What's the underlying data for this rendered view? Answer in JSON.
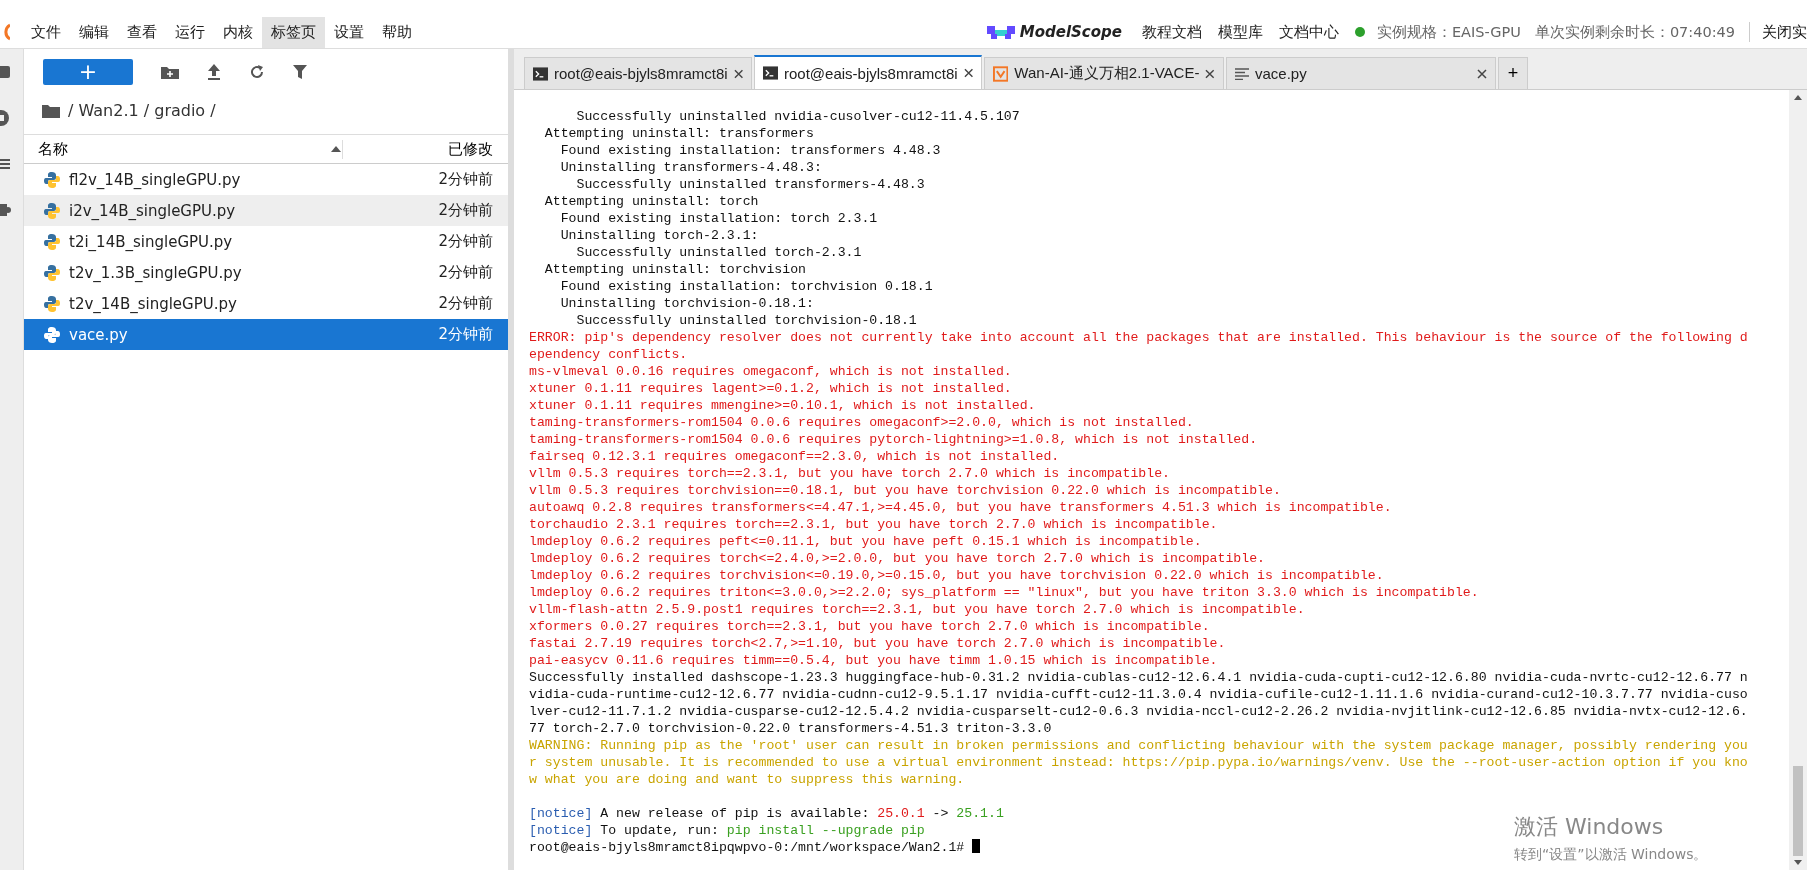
{
  "menu_bar": {
    "items": [
      {
        "label": "文件",
        "selected": false
      },
      {
        "label": "编辑",
        "selected": false
      },
      {
        "label": "查看",
        "selected": false
      },
      {
        "label": "运行",
        "selected": false
      },
      {
        "label": "内核",
        "selected": false
      },
      {
        "label": "标签页",
        "selected": true
      },
      {
        "label": "设置",
        "selected": false
      },
      {
        "label": "帮助",
        "selected": false
      }
    ],
    "brand": "ModelScope",
    "links": [
      "教程文档",
      "模型库",
      "文档中心"
    ],
    "instance_spec": "实例规格：EAIS-GPU",
    "time_left": "单次实例剩余时长：07:40:49",
    "close_button": "关闭实"
  },
  "file_browser": {
    "new_button": "+",
    "breadcrumb": "/ Wan2.1 / gradio /",
    "columns": [
      "名称",
      "已修改"
    ],
    "files": [
      {
        "name": "fl2v_14B_singleGPU.py",
        "modified": "2分钟前",
        "selected": false,
        "hovered": false
      },
      {
        "name": "i2v_14B_singleGPU.py",
        "modified": "2分钟前",
        "selected": false,
        "hovered": true
      },
      {
        "name": "t2i_14B_singleGPU.py",
        "modified": "2分钟前",
        "selected": false,
        "hovered": false
      },
      {
        "name": "t2v_1.3B_singleGPU.py",
        "modified": "2分钟前",
        "selected": false,
        "hovered": false
      },
      {
        "name": "t2v_14B_singleGPU.py",
        "modified": "2分钟前",
        "selected": false,
        "hovered": false
      },
      {
        "name": "vace.py",
        "modified": "2分钟前",
        "selected": true,
        "hovered": false
      }
    ]
  },
  "tabs": [
    {
      "kind": "terminal",
      "label": "root@eais-bjyls8mramct8i",
      "selected": false
    },
    {
      "kind": "terminal",
      "label": "root@eais-bjyls8mramct8i",
      "selected": true
    },
    {
      "kind": "web",
      "label": "Wan-AI-通义万相2.1-VACE-",
      "selected": false
    },
    {
      "kind": "file",
      "label": "vace.py",
      "selected": false
    }
  ],
  "new_tab_button": "+",
  "terminal": {
    "lines": [
      {
        "kind": "output",
        "text": "      Successfully uninstalled nvidia-cusolver-cu12-11.4.5.107"
      },
      {
        "kind": "output",
        "text": "  Attempting uninstall: transformers"
      },
      {
        "kind": "output",
        "text": "    Found existing installation: transformers 4.48.3"
      },
      {
        "kind": "output",
        "text": "    Uninstalling transformers-4.48.3:"
      },
      {
        "kind": "output",
        "text": "      Successfully uninstalled transformers-4.48.3"
      },
      {
        "kind": "output",
        "text": "  Attempting uninstall: torch"
      },
      {
        "kind": "output",
        "text": "    Found existing installation: torch 2.3.1"
      },
      {
        "kind": "output",
        "text": "    Uninstalling torch-2.3.1:"
      },
      {
        "kind": "output",
        "text": "      Successfully uninstalled torch-2.3.1"
      },
      {
        "kind": "output",
        "text": "  Attempting uninstall: torchvision"
      },
      {
        "kind": "output",
        "text": "    Found existing installation: torchvision 0.18.1"
      },
      {
        "kind": "output",
        "text": "    Uninstalling torchvision-0.18.1:"
      },
      {
        "kind": "output",
        "text": "      Successfully uninstalled torchvision-0.18.1"
      },
      {
        "kind": "error",
        "text": "ERROR: pip's dependency resolver does not currently take into account all the packages that are installed. This behaviour is the source of the following d"
      },
      {
        "kind": "error",
        "text": "ependency conflicts."
      },
      {
        "kind": "error",
        "text": "ms-vlmeval 0.0.16 requires omegaconf, which is not installed."
      },
      {
        "kind": "error",
        "text": "xtuner 0.1.11 requires lagent>=0.1.2, which is not installed."
      },
      {
        "kind": "error",
        "text": "xtuner 0.1.11 requires mmengine>=0.10.1, which is not installed."
      },
      {
        "kind": "error",
        "text": "taming-transformers-rom1504 0.0.6 requires omegaconf>=2.0.0, which is not installed."
      },
      {
        "kind": "error",
        "text": "taming-transformers-rom1504 0.0.6 requires pytorch-lightning>=1.0.8, which is not installed."
      },
      {
        "kind": "error",
        "text": "fairseq 0.12.3.1 requires omegaconf==2.3.0, which is not installed."
      },
      {
        "kind": "error",
        "text": "vllm 0.5.3 requires torch==2.3.1, but you have torch 2.7.0 which is incompatible."
      },
      {
        "kind": "error",
        "text": "vllm 0.5.3 requires torchvision==0.18.1, but you have torchvision 0.22.0 which is incompatible."
      },
      {
        "kind": "error",
        "text": "autoawq 0.2.8 requires transformers<=4.47.1,>=4.45.0, but you have transformers 4.51.3 which is incompatible."
      },
      {
        "kind": "error",
        "text": "torchaudio 2.3.1 requires torch==2.3.1, but you have torch 2.7.0 which is incompatible."
      },
      {
        "kind": "error",
        "text": "lmdeploy 0.6.2 requires peft<=0.11.1, but you have peft 0.15.1 which is incompatible."
      },
      {
        "kind": "error",
        "text": "lmdeploy 0.6.2 requires torch<=2.4.0,>=2.0.0, but you have torch 2.7.0 which is incompatible."
      },
      {
        "kind": "error",
        "text": "lmdeploy 0.6.2 requires torchvision<=0.19.0,>=0.15.0, but you have torchvision 0.22.0 which is incompatible."
      },
      {
        "kind": "error",
        "text": "lmdeploy 0.6.2 requires triton<=3.0.0,>=2.2.0; sys_platform == \"linux\", but you have triton 3.3.0 which is incompatible."
      },
      {
        "kind": "error",
        "text": "vllm-flash-attn 2.5.9.post1 requires torch==2.3.1, but you have torch 2.7.0 which is incompatible."
      },
      {
        "kind": "error",
        "text": "xformers 0.0.27 requires torch==2.3.1, but you have torch 2.7.0 which is incompatible."
      },
      {
        "kind": "error",
        "text": "fastai 2.7.19 requires torch<2.7,>=1.10, but you have torch 2.7.0 which is incompatible."
      },
      {
        "kind": "error",
        "text": "pai-easycv 0.11.6 requires timm==0.5.4, but you have timm 1.0.15 which is incompatible."
      },
      {
        "kind": "output",
        "text": "Successfully installed dashscope-1.23.3 huggingface-hub-0.31.2 nvidia-cublas-cu12-12.6.4.1 nvidia-cuda-cupti-cu12-12.6.80 nvidia-cuda-nvrtc-cu12-12.6.77 n"
      },
      {
        "kind": "output",
        "text": "vidia-cuda-runtime-cu12-12.6.77 nvidia-cudnn-cu12-9.5.1.17 nvidia-cufft-cu12-11.3.0.4 nvidia-cufile-cu12-1.11.1.6 nvidia-curand-cu12-10.3.7.77 nvidia-cuso"
      },
      {
        "kind": "output",
        "text": "lver-cu12-11.7.1.2 nvidia-cusparse-cu12-12.5.4.2 nvidia-cusparselt-cu12-0.6.3 nvidia-nccl-cu12-2.26.2 nvidia-nvjitlink-cu12-12.6.85 nvidia-nvtx-cu12-12.6."
      },
      {
        "kind": "output",
        "text": "77 torch-2.7.0 torchvision-0.22.0 transformers-4.51.3 triton-3.3.0"
      },
      {
        "kind": "warning",
        "text": "WARNING: Running pip as the 'root' user can result in broken permissions and conflicting behaviour with the system package manager, possibly rendering you"
      },
      {
        "kind": "warning",
        "text": "r system unusable. It is recommended to use a virtual environment instead: https://pip.pypa.io/warnings/venv. Use the --root-user-action option if you kno"
      },
      {
        "kind": "warning",
        "text": "w what you are doing and want to suppress this warning."
      },
      {
        "kind": "blank"
      },
      {
        "kind": "mixed",
        "segments": [
          {
            "kind": "notice",
            "text": "[notice]"
          },
          {
            "kind": "output",
            "text": " A new release of pip is available: "
          },
          {
            "kind": "old",
            "text": "25.0.1"
          },
          {
            "kind": "output",
            "text": " -> "
          },
          {
            "kind": "new",
            "text": "25.1.1"
          }
        ]
      },
      {
        "kind": "mixed",
        "segments": [
          {
            "kind": "notice",
            "text": "[notice]"
          },
          {
            "kind": "output",
            "text": " To update, run: "
          },
          {
            "kind": "new",
            "text": "pip install --upgrade pip"
          }
        ]
      },
      {
        "kind": "prompt",
        "text": "root@eais-bjyls8mramct8ipqwpvo-0:/mnt/workspace/Wan2.1# "
      }
    ]
  },
  "os_notice": {
    "title": "激活 Windows",
    "subtitle": "转到“设置”以激活 Windows。"
  }
}
